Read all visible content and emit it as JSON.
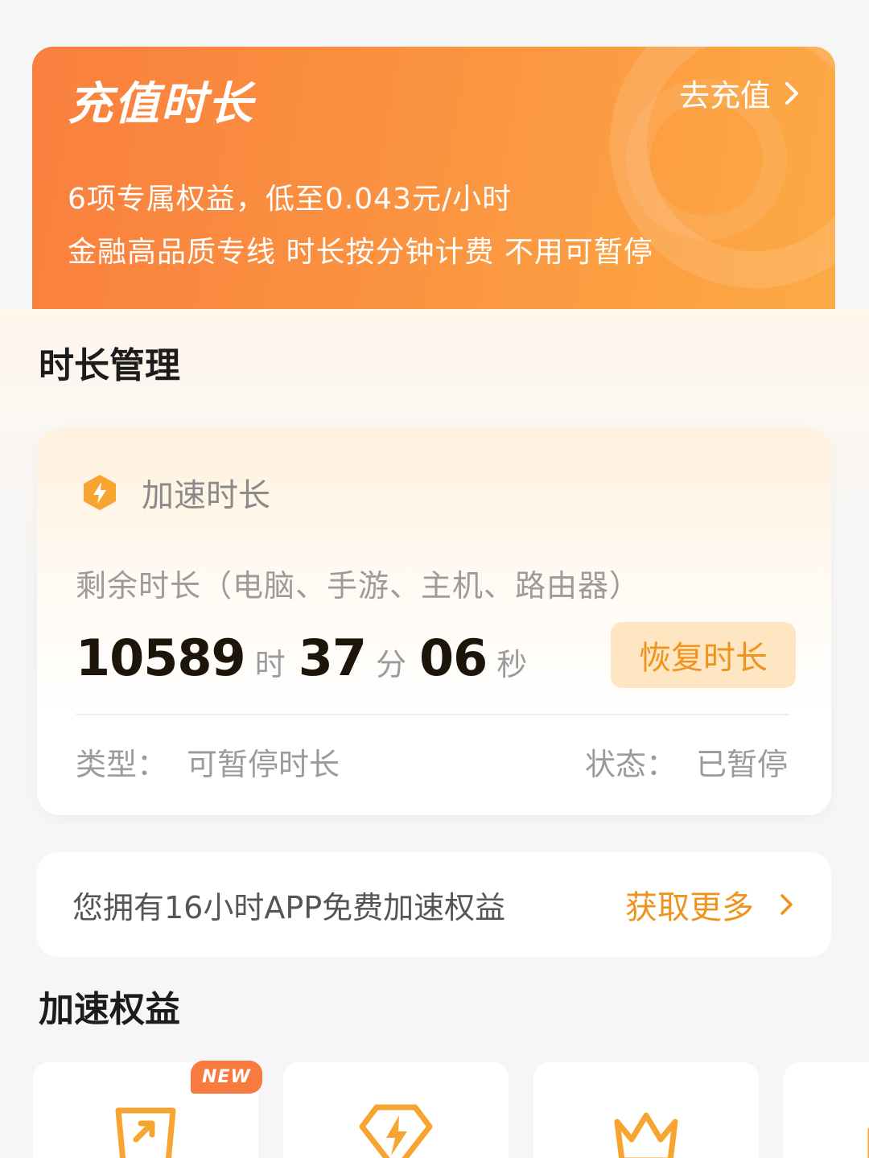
{
  "banner": {
    "title": "充值时长",
    "cta": "去充值",
    "line1": "6项专属权益，低至0.043元/小时",
    "line2": "金融高品质专线 时长按分钟计费 不用可暂停",
    "gradient_start": "#f97f3e",
    "gradient_end": "#fcaa45"
  },
  "sections": {
    "duration_title": "时长管理",
    "benefits_title": "加速权益"
  },
  "duration_card": {
    "icon": "lightning-hexagon-icon",
    "title": "加速时长",
    "remain_label": "剩余时长（电脑、手游、主机、路由器）",
    "hours": "10589",
    "hours_unit": "时",
    "minutes": "37",
    "minutes_unit": "分",
    "seconds": "06",
    "seconds_unit": "秒",
    "restore_button": "恢复时长",
    "type_label": "类型：",
    "type_value": "可暂停时长",
    "status_label": "状态：",
    "status_value": "已暂停"
  },
  "free_benefit": {
    "text": "您拥有16小时APP免费加速权益",
    "more": "获取更多"
  },
  "benefit_tiles": [
    {
      "icon": "boost-arrow-icon",
      "badge": "NEW"
    },
    {
      "icon": "lightning-diamond-icon"
    },
    {
      "icon": "crown-icon"
    },
    {
      "icon": "partial-icon"
    }
  ],
  "colors": {
    "accent": "#f0931d",
    "button_bg": "#ffe6c2",
    "badge_bg": "#f97a3f"
  }
}
